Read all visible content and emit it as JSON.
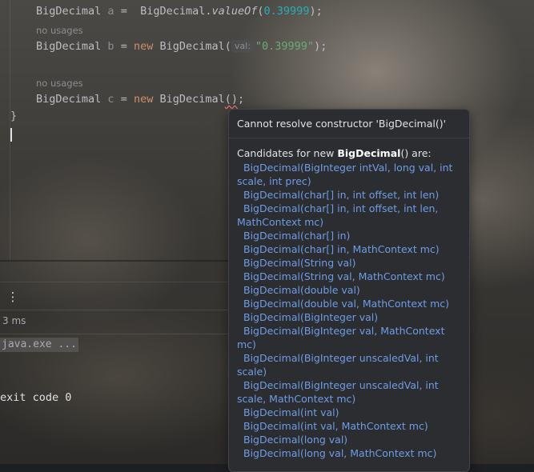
{
  "editor": {
    "line1": {
      "type": "BigDecimal",
      "var": "a",
      "assign": " =  ",
      "cls": "BigDecimal",
      "method": "valueOf",
      "open": "(",
      "num": "0.39999",
      "close": ");"
    },
    "hint1": "no usages",
    "line2": {
      "type": "BigDecimal",
      "var": "b",
      "assign": " = ",
      "kw": "new",
      "cls": "BigDecimal(",
      "param_hint": "val:",
      "str": "\"0.39999\"",
      "close": ");"
    },
    "hint2": "no usages",
    "line3": {
      "type": "BigDecimal",
      "var": "c",
      "assign": " = ",
      "kw": "new",
      "cls": "BigDecimal",
      "error_part": "()",
      "close": ";"
    },
    "closing_brace": "}"
  },
  "run_panel": {
    "more_icon": "⋮",
    "timing": "3 ms",
    "command": "java.exe ...",
    "exit_line": "exit code 0"
  },
  "popup": {
    "title": "Cannot resolve constructor 'BigDecimal()'",
    "candidates_prefix": "Candidates for new ",
    "candidates_bold": "BigDecimal",
    "candidates_suffix": "() are:",
    "candidates": [
      "BigDecimal(BigInteger intVal, long val, int scale, int prec)",
      "BigDecimal(char[] in, int offset, int len)",
      "BigDecimal(char[] in, int offset, int len, MathContext mc)",
      "BigDecimal(char[] in)",
      "BigDecimal(char[] in, MathContext mc)",
      "BigDecimal(String val)",
      "BigDecimal(String val, MathContext mc)",
      "BigDecimal(double val)",
      "BigDecimal(double val, MathContext mc)",
      "BigDecimal(BigInteger val)",
      "BigDecimal(BigInteger val, MathContext mc)",
      "BigDecimal(BigInteger unscaledVal, int scale)",
      "BigDecimal(BigInteger unscaledVal, int scale, MathContext mc)",
      "BigDecimal(int val)",
      "BigDecimal(int val, MathContext mc)",
      "BigDecimal(long val)",
      "BigDecimal(long val, MathContext mc)"
    ]
  },
  "colors": {
    "keyword": "#cf8e6d",
    "number": "#2aacb8",
    "string": "#6aab73",
    "link": "#6f9ce6",
    "error_underline": "#e06c75"
  }
}
